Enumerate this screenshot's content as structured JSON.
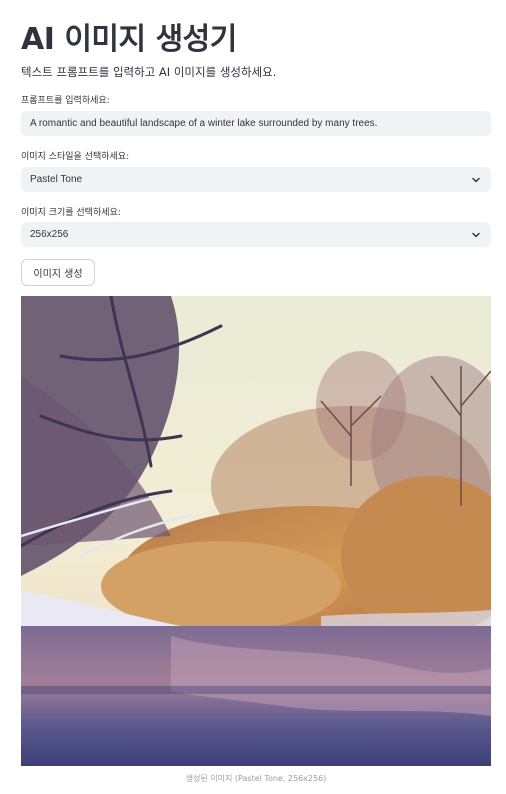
{
  "header": {
    "title": "AI 이미지 생성기",
    "subtitle": "텍스트 프롬프트를 입력하고 AI 이미지를 생성하세요."
  },
  "prompt": {
    "label": "프롬프트를 입력하세요:",
    "value": "A romantic and beautiful landscape of a winter lake surrounded by many trees."
  },
  "style": {
    "label": "이미지 스타일을 선택하세요:",
    "selected": "Pastel Tone"
  },
  "size": {
    "label": "이미지 크기를 선택하세요:",
    "selected": "256x256"
  },
  "actions": {
    "generate_label": "이미지 생성"
  },
  "result": {
    "caption": "생성된 이미지 (Pastel Tone, 256x256)"
  },
  "colors": {
    "input_bg": "#f0f2f6",
    "text": "#31333f",
    "caption": "#9a9ca5"
  }
}
